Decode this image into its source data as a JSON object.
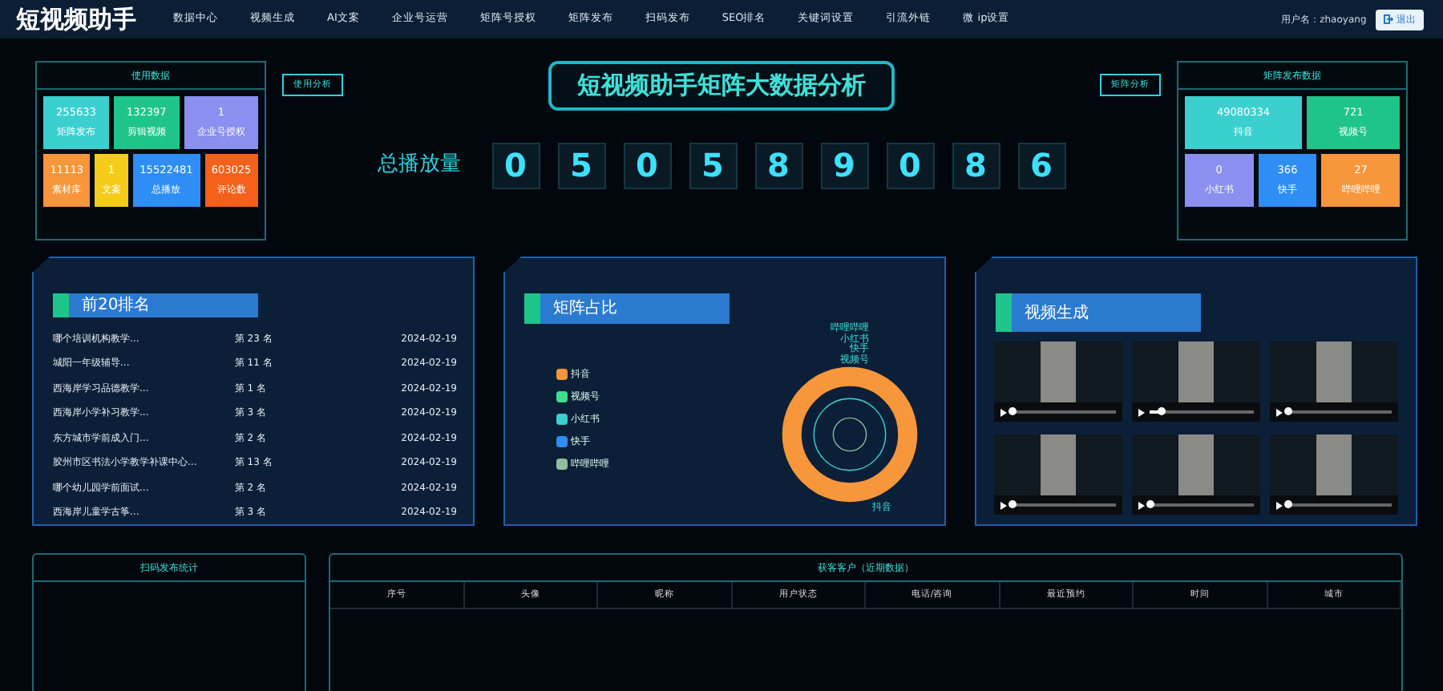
{
  "header": {
    "logo": "短视频助手",
    "nav": [
      {
        "label": "数据中心",
        "selected": false
      },
      {
        "label": "视频生成",
        "selected": false
      },
      {
        "label": "AI文案",
        "selected": false
      },
      {
        "label": "企业号运营",
        "selected": false
      },
      {
        "label": "矩阵号授权",
        "selected": false
      },
      {
        "label": "矩阵发布",
        "selected": false
      },
      {
        "label": "扫码发布",
        "selected": false
      },
      {
        "label": "SEO排名",
        "selected": false
      },
      {
        "label": "关键词设置",
        "selected": false
      },
      {
        "label": "引流外链",
        "selected": false
      },
      {
        "label": "微 ip设置",
        "selected": false
      }
    ],
    "user_label": "用户名：zhaoyang",
    "logout": "退出"
  },
  "usage_panel": {
    "title": "使用数据",
    "tiles": [
      {
        "value": "255633",
        "label": "矩阵发布",
        "color": "#3ccfcf"
      },
      {
        "value": "132397",
        "label": "剪辑视频",
        "color": "#1fc48a"
      },
      {
        "value": "1",
        "label": "企业号授权",
        "color": "#8a8ff0"
      },
      {
        "value": "11113",
        "label": "素材库",
        "color": "#f7963a"
      },
      {
        "value": "1",
        "label": "文案",
        "color": "#f5cc1a"
      },
      {
        "value": "15522481",
        "label": "总播放",
        "color": "#2f8ef5"
      },
      {
        "value": "603025",
        "label": "评论数",
        "color": "#f5601a"
      }
    ]
  },
  "center": {
    "title": "短视频助手矩阵大数据分析",
    "left_tag": "使用分析",
    "right_tag": "矩阵分析",
    "total_label": "总播放量",
    "digits": [
      "0",
      "5",
      "0",
      "5",
      "8",
      "9",
      "0",
      "8",
      "6"
    ]
  },
  "matrix_panel": {
    "title": "矩阵发布数据",
    "tiles": [
      {
        "value": "49080334",
        "label": "抖音",
        "color": "#3ccfcf"
      },
      {
        "value": "721",
        "label": "视频号",
        "color": "#1fc48a"
      },
      {
        "value": "0",
        "label": "小红书",
        "color": "#8a8ff0"
      },
      {
        "value": "366",
        "label": "快手",
        "color": "#2f8ef5"
      },
      {
        "value": "27",
        "label": "哔哩哔哩",
        "color": "#f7963a"
      }
    ]
  },
  "ranking": {
    "title": "前20排名",
    "rows": [
      {
        "name": "哪个培训机构教学...",
        "rank": "第 23 名",
        "date": "2024-02-19"
      },
      {
        "name": "城阳一年级辅导...",
        "rank": "第 11 名",
        "date": "2024-02-19"
      },
      {
        "name": "西海岸学习品德教学...",
        "rank": "第 1 名",
        "date": "2024-02-19"
      },
      {
        "name": "西海岸小学补习教学...",
        "rank": "第 3 名",
        "date": "2024-02-19"
      },
      {
        "name": "东方城市学前成入门...",
        "rank": "第 2 名",
        "date": "2024-02-19"
      },
      {
        "name": "胶州市区书法小学教学补课中心...",
        "rank": "第 13 名",
        "date": "2024-02-19"
      },
      {
        "name": "哪个幼儿园学前面试...",
        "rank": "第 2 名",
        "date": "2024-02-19"
      },
      {
        "name": "西海岸儿童学古筝...",
        "rank": "第 3 名",
        "date": "2024-02-19"
      }
    ]
  },
  "share": {
    "title": "矩阵占比",
    "legend": [
      {
        "label": "抖音",
        "color": "#f7963a"
      },
      {
        "label": "视频号",
        "color": "#3ee08c"
      },
      {
        "label": "小红书",
        "color": "#3ccfcf"
      },
      {
        "label": "快手",
        "color": "#2f8ef5"
      },
      {
        "label": "哔哩哔哩",
        "color": "#8fbf9f"
      }
    ],
    "ring_labels": [
      "哔哩哔哩",
      "小红书",
      "快手",
      "视频号",
      "抖音"
    ]
  },
  "videos": {
    "title": "视频生成",
    "items": [
      {
        "level": 0
      },
      {
        "level": 0.1
      },
      {
        "level": 0
      },
      {
        "level": 0
      },
      {
        "level": 0
      },
      {
        "level": 0
      }
    ]
  },
  "scan_stats": {
    "title": "扫码发布统计"
  },
  "customers": {
    "title": "获客客户（近期数据）",
    "columns": [
      "序号",
      "头像",
      "昵称",
      "用户状态",
      "电话/咨询",
      "最近预约",
      "时间",
      "城市"
    ]
  }
}
